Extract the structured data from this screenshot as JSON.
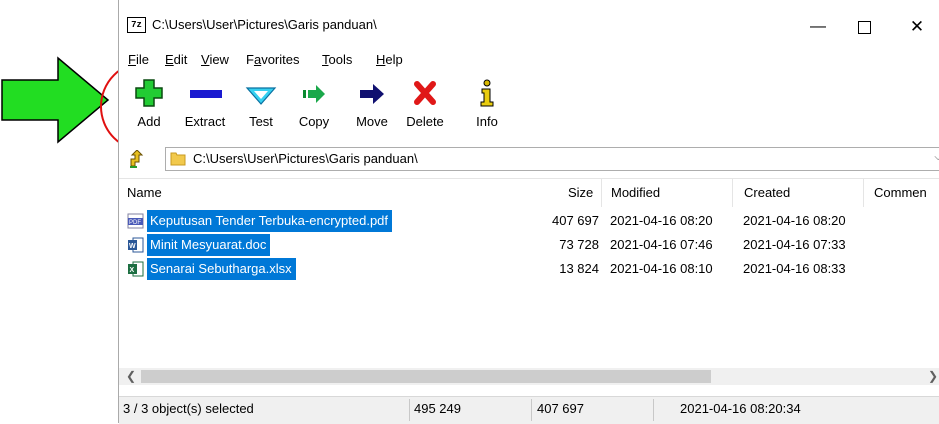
{
  "window": {
    "title": "C:\\Users\\User\\Pictures\\Garis panduan\\",
    "app_icon_text": "7z"
  },
  "menu": [
    {
      "pre": "",
      "ul": "F",
      "post": "ile"
    },
    {
      "pre": "",
      "ul": "E",
      "post": "dit"
    },
    {
      "pre": "",
      "ul": "V",
      "post": "iew"
    },
    {
      "pre": "F",
      "ul": "a",
      "post": "vorites"
    },
    {
      "pre": "",
      "ul": "T",
      "post": "ools"
    },
    {
      "pre": "",
      "ul": "H",
      "post": "elp"
    }
  ],
  "toolbar": {
    "add": "Add",
    "extract": "Extract",
    "test": "Test",
    "copy": "Copy",
    "move": "Move",
    "delete": "Delete",
    "info": "Info"
  },
  "address": {
    "path": "C:\\Users\\User\\Pictures\\Garis panduan\\"
  },
  "columns": {
    "name": "Name",
    "size": "Size",
    "modified": "Modified",
    "created": "Created",
    "comment": "Commen"
  },
  "files": [
    {
      "name": "Keputusan Tender Terbuka-encrypted.pdf",
      "size": "407 697",
      "modified": "2021-04-16 08:20",
      "created": "2021-04-16 08:20",
      "icon": "pdf-file-icon"
    },
    {
      "name": "Minit Mesyuarat.doc",
      "size": "73 728",
      "modified": "2021-04-16 07:46",
      "created": "2021-04-16 07:33",
      "icon": "word-file-icon"
    },
    {
      "name": "Senarai Sebutharga.xlsx",
      "size": "13 824",
      "modified": "2021-04-16 08:10",
      "created": "2021-04-16 08:33",
      "icon": "excel-file-icon"
    }
  ],
  "status": {
    "selected": "3 / 3 object(s) selected",
    "total_size": "495 249",
    "selected_size": "407 697",
    "modified": "2021-04-16 08:20:34"
  },
  "colors": {
    "selection": "#0078d7",
    "annotation_arrow": "#22dd22",
    "annotation_circle": "#e01010"
  }
}
